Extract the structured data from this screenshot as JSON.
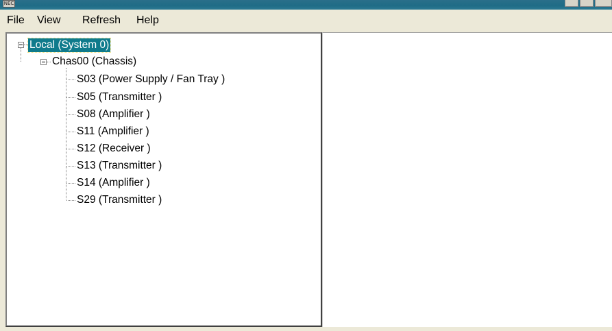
{
  "window": {
    "title": "",
    "app_icon_label": "NEC"
  },
  "menu": {
    "file": "File",
    "view": "View",
    "refresh": "Refresh",
    "help": "Help"
  },
  "tree": {
    "root": {
      "label": "Local (System 0)",
      "expanded": true,
      "selected": true
    },
    "chassis": {
      "label": "Chas00 (Chassis)",
      "expanded": true
    },
    "slots": [
      {
        "label": "S03 (Power Supply / Fan Tray )"
      },
      {
        "label": "S05 (Transmitter )"
      },
      {
        "label": "S08 (Amplifier )"
      },
      {
        "label": "S11 (Amplifier )"
      },
      {
        "label": "S12 (Receiver )"
      },
      {
        "label": "S13 (Transmitter )"
      },
      {
        "label": "S14 (Amplifier )"
      },
      {
        "label": "S29 (Transmitter )"
      }
    ]
  },
  "colors": {
    "selection": "#0f7b8c",
    "titlebar": "#1f6c86",
    "chrome": "#ece9d8"
  }
}
